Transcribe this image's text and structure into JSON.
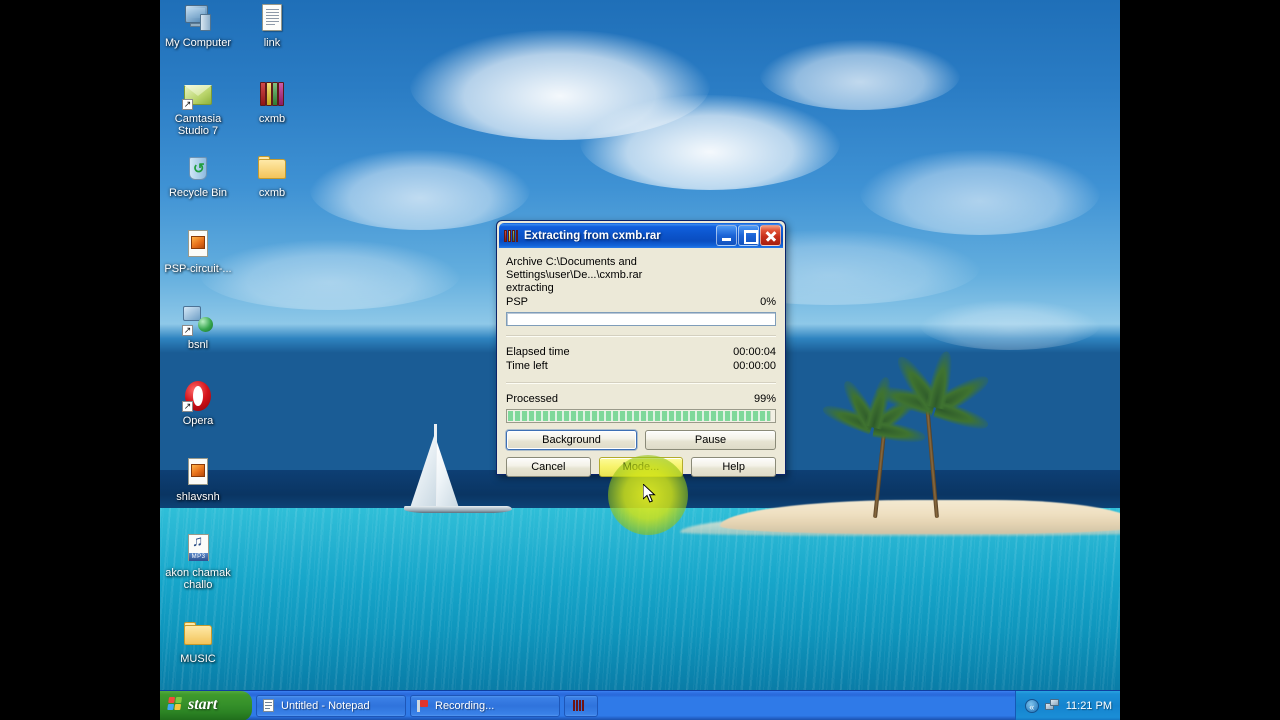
{
  "desktop": {
    "icons": [
      {
        "label": "My Computer",
        "icon": "my-computer-icon"
      },
      {
        "label": "link",
        "icon": "text-document-icon"
      },
      {
        "label": "Camtasia Studio 7",
        "icon": "camtasia-studio-icon"
      },
      {
        "label": "cxmb",
        "icon": "winrar-archive-icon"
      },
      {
        "label": "Recycle Bin",
        "icon": "recycle-bin-icon"
      },
      {
        "label": "cxmb",
        "icon": "folder-icon"
      },
      {
        "label": "PSP-circuit-...",
        "icon": "psp-file-icon"
      },
      {
        "label": "bsnl",
        "icon": "network-connection-icon"
      },
      {
        "label": "Opera",
        "icon": "opera-browser-icon"
      },
      {
        "label": "shlavsnh",
        "icon": "psp-file-icon"
      },
      {
        "label": "akon chamak challo",
        "icon": "mp3-audio-icon"
      },
      {
        "label": "MUSIC",
        "icon": "folder-icon"
      }
    ]
  },
  "taskbar": {
    "start_label": "start",
    "items": [
      {
        "label": "Untitled - Notepad",
        "icon": "notepad-icon"
      },
      {
        "label": "Recording...",
        "icon": "camtasia-recorder-icon"
      },
      {
        "label": "",
        "icon": "winrar-icon"
      }
    ],
    "tray": {
      "chevron": "«",
      "network_icon": "network-activity-icon",
      "clock": "11:21 PM"
    }
  },
  "dialog": {
    "title": "Extracting from cxmb.rar",
    "title_icon": "winrar-books-icon",
    "window_buttons": {
      "minimize": "minimize-button",
      "maximize": "maximize-button",
      "close": "close-button"
    },
    "archive_line": "Archive C:\\Documents and Settings\\user\\De...\\cxmb.rar",
    "status_line": "extracting",
    "current_file": {
      "name": "PSP",
      "percent_label": "0%",
      "percent_value": 0
    },
    "elapsed": {
      "label": "Elapsed time",
      "value": "00:00:04"
    },
    "time_left": {
      "label": "Time left",
      "value": "00:00:00"
    },
    "processed": {
      "label": "Processed",
      "percent_label": "99%",
      "percent_value": 99
    },
    "buttons": {
      "background": "Background",
      "pause": "Pause",
      "cancel": "Cancel",
      "mode": "Mode...",
      "help": "Help"
    }
  },
  "colors": {
    "dialog_face": "#ece9d8",
    "title_blue": "#0a4dc0",
    "progress_green": "#7fd89a",
    "taskbar_blue": "#2f7ae8",
    "start_green": "#35902a",
    "click_highlight": "#e8f21e"
  }
}
